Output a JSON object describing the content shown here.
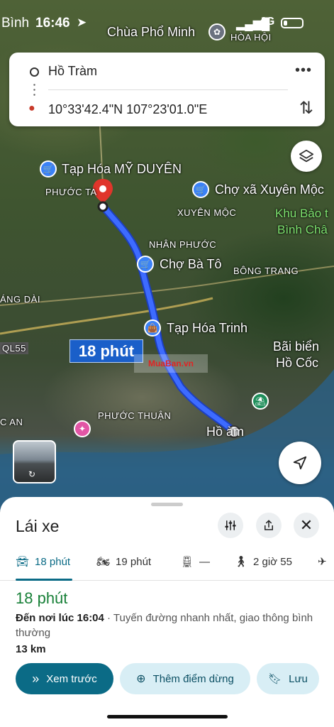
{
  "status_bar": {
    "carrier_hint": "Bình",
    "time": "16:46",
    "network": "4G"
  },
  "route": {
    "origin": "Hồ Tràm",
    "destination": "10°33'42.4\"N 107°23'01.0\"E"
  },
  "map": {
    "labels": {
      "chua_pho_minh": "Chùa Phổ Minh",
      "hoa_hoi": "HÒA HỘI",
      "tap_hoa_my_duyen": "Tạp Hóa MỸ DUYÊN",
      "phuoc_tan": "PHƯỚC TA",
      "cho_xa_xuyen_moc": "Chợ xã Xuyên Mộc",
      "xuyen_moc": "XUYÊN MỘC",
      "khu_bao_ton": "Khu Bảo t",
      "binh_chau": "Bình Châ",
      "nhan_phuoc": "NHÂN PHƯỚC",
      "cho_ba_to": "Chợ Bà Tô",
      "bong_trang": "BÔNG TRANG",
      "ang_dai": "ÁNG DÀI",
      "ql55": "QL55",
      "tap_hoa_trinh": "Tạp Hóa Trinh",
      "bai_bien": "Bãi biển",
      "ho_coc": "Hồ Cốc",
      "phuoc_thuan": "PHƯỚC THUẬN",
      "c_an": "C AN",
      "ho_tram_end": "Hồ  àm"
    },
    "route_time_badge": "18 phút",
    "watermark_line1": "Mua",
    "watermark_line2": "Ban.vn",
    "route_color": "#2f5ff0"
  },
  "sheet": {
    "title": "Lái xe",
    "modes": [
      {
        "label": "18 phút",
        "icon": "car-icon",
        "active": true
      },
      {
        "label": "19 phút",
        "icon": "motorbike-icon",
        "active": false
      },
      {
        "label": "—",
        "icon": "transit-icon",
        "active": false
      },
      {
        "label": "2 giờ 55",
        "icon": "walk-icon",
        "active": false
      }
    ],
    "eta": "18 phút",
    "arrive_bold": "Đến nơi lúc 16:04",
    "arrive_rest": " · Tuyến đường nhanh nhất, giao thông bình thường",
    "distance": "13 km",
    "buttons": {
      "preview": "Xem trước",
      "add_stop": "Thêm điểm dừng",
      "save": "Lưu"
    },
    "accent_color": "#0b6b86"
  }
}
